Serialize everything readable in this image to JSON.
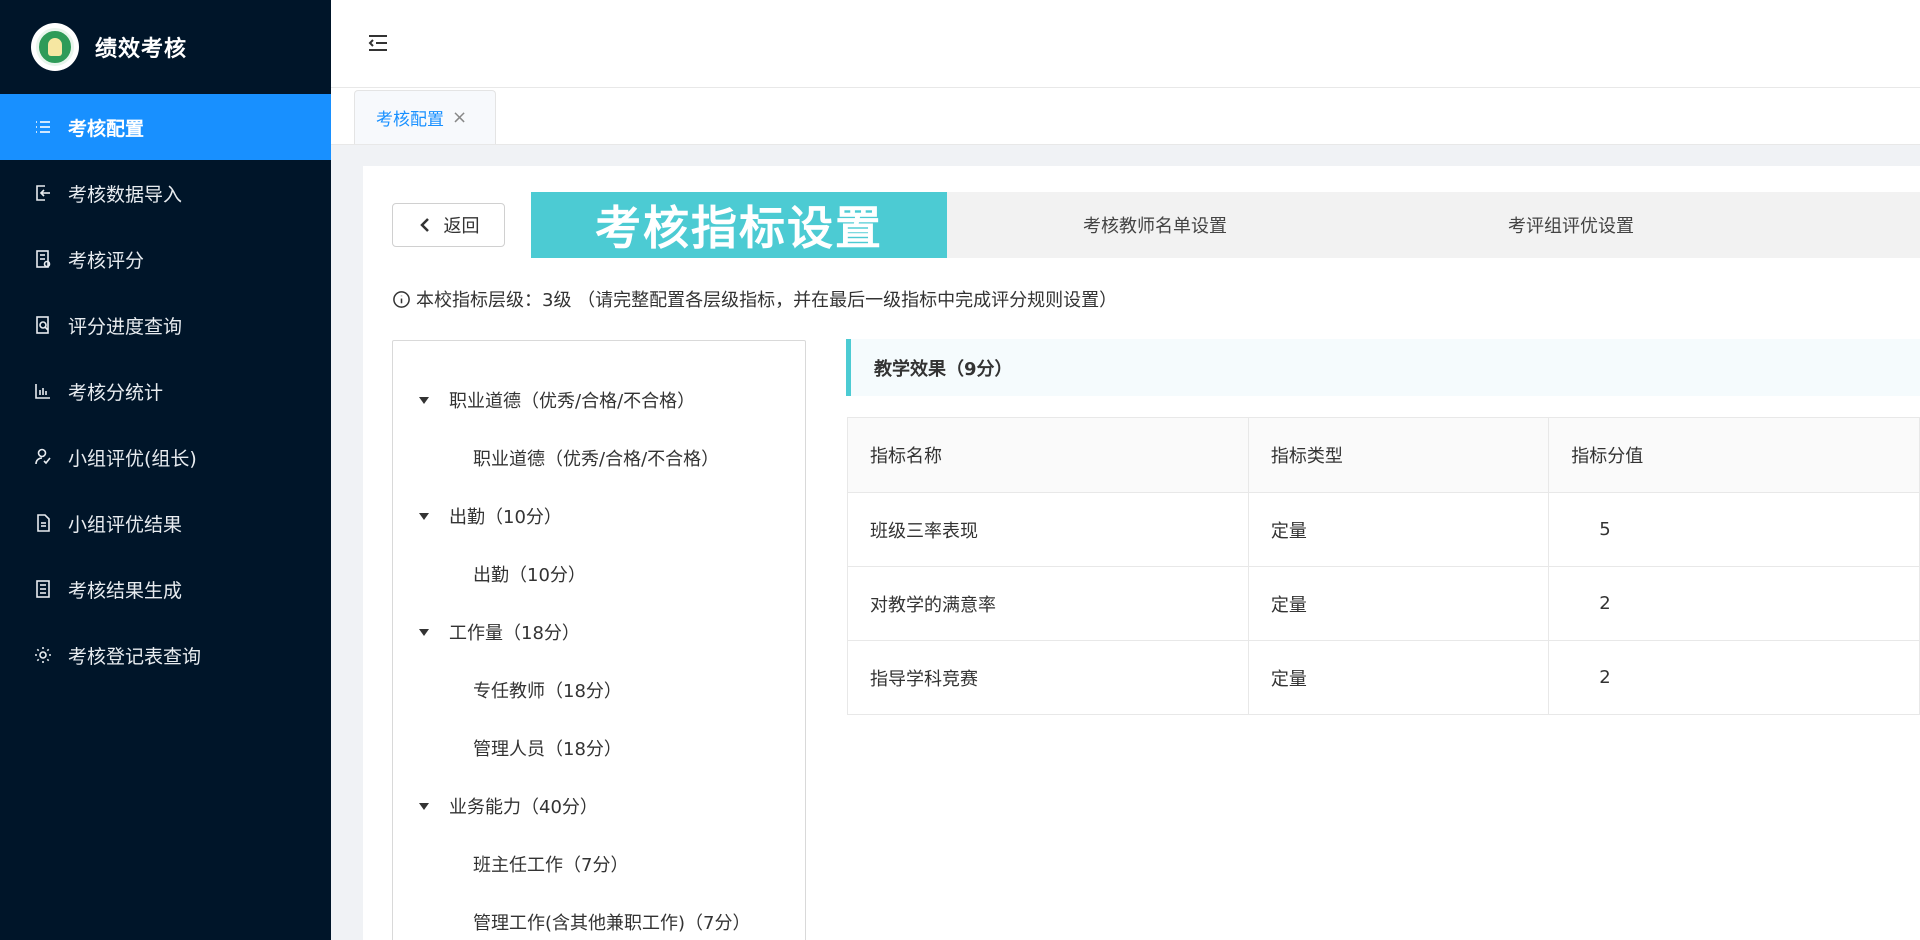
{
  "brand": {
    "title": "绩效考核",
    "logo_icon": "school-logo"
  },
  "sidebar": {
    "items": [
      {
        "label": "考核配置",
        "icon": "list-icon",
        "active": true
      },
      {
        "label": "考核数据导入",
        "icon": "import-icon",
        "active": false
      },
      {
        "label": "考核评分",
        "icon": "grade-icon",
        "active": false
      },
      {
        "label": "评分进度查询",
        "icon": "search-doc-icon",
        "active": false
      },
      {
        "label": "考核分统计",
        "icon": "bar-chart-icon",
        "active": false
      },
      {
        "label": "小组评优(组长)",
        "icon": "user-group-icon",
        "active": false
      },
      {
        "label": "小组评优结果",
        "icon": "file-icon",
        "active": false
      },
      {
        "label": "考核结果生成",
        "icon": "document-icon",
        "active": false
      },
      {
        "label": "考核登记表查询",
        "icon": "gear-icon",
        "active": false
      }
    ]
  },
  "tabs": [
    {
      "label": "考核配置",
      "closable": true
    }
  ],
  "toolbar": {
    "back_label": "返回"
  },
  "steps": [
    {
      "label": "考核指标设置",
      "active": true
    },
    {
      "label": "考核教师名单设置",
      "active": false
    },
    {
      "label": "考评组评优设置",
      "active": false
    }
  ],
  "hint": "本校指标层级：3级 （请完整配置各层级指标，并在最后一级指标中完成评分规则设置）",
  "tree": [
    {
      "label": "职业道德（优秀/合格/不合格）",
      "level": 1
    },
    {
      "label": "职业道德（优秀/合格/不合格）",
      "level": 2
    },
    {
      "label": "出勤（10分）",
      "level": 1
    },
    {
      "label": "出勤（10分）",
      "level": 2
    },
    {
      "label": "工作量（18分）",
      "level": 1
    },
    {
      "label": "专任教师（18分）",
      "level": 2
    },
    {
      "label": "管理人员（18分）",
      "level": 2
    },
    {
      "label": "业务能力（40分）",
      "level": 1
    },
    {
      "label": "班主任工作（7分）",
      "level": 2
    },
    {
      "label": "管理工作(含其他兼职工作)（7分）",
      "level": 2
    }
  ],
  "section": {
    "title": "教学效果（9分）"
  },
  "table": {
    "headers": [
      "指标名称",
      "指标类型",
      "指标分值"
    ],
    "rows": [
      [
        "班级三率表现",
        "定量",
        "5"
      ],
      [
        "对教学的满意率",
        "定量",
        "2"
      ],
      [
        "指导学科竞赛",
        "定量",
        "2"
      ]
    ]
  },
  "colors": {
    "sidebar_bg": "#001529",
    "accent": "#1890ff",
    "teal": "#4ccbd3",
    "score_blue": "#1a8fe3"
  }
}
